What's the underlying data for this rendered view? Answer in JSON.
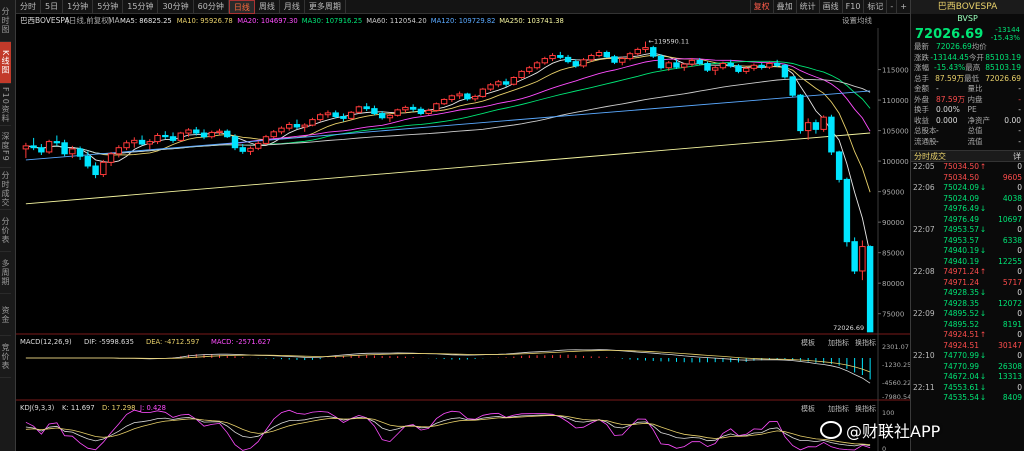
{
  "sidebar": {
    "items": [
      {
        "label": "分时图",
        "active": false
      },
      {
        "label": "K线图",
        "active": true
      },
      {
        "label": "F10资料",
        "active": false
      },
      {
        "label": "深度F9",
        "active": false
      },
      {
        "label": "分时成交",
        "active": false
      },
      {
        "label": "分价表",
        "active": false
      },
      {
        "label": "多周期",
        "active": false
      },
      {
        "label": "资金",
        "active": false
      },
      {
        "label": "竞价表",
        "active": false
      }
    ]
  },
  "toolbar": {
    "periods": [
      "分时",
      "5日",
      "1分钟",
      "5分钟",
      "15分钟",
      "30分钟",
      "60分钟",
      "日线",
      "周线",
      "月线",
      "更多周期"
    ],
    "active_period": "日线",
    "right_items": [
      {
        "label": "复权",
        "color": "red"
      },
      {
        "label": "叠加",
        "color": "normal"
      },
      {
        "label": "统计",
        "color": "normal"
      },
      {
        "label": "画线",
        "color": "normal"
      },
      {
        "label": "F10",
        "color": "normal"
      },
      {
        "label": "标记",
        "color": "normal"
      },
      {
        "label": "-",
        "color": "normal"
      },
      {
        "label": "+",
        "color": "normal"
      }
    ]
  },
  "main_chart": {
    "header": {
      "name": "巴西BOVESPA",
      "mode": "(日线,前复权)",
      "ma_label": "MA",
      "ma_values": [
        {
          "text": "MA5: 86825.25",
          "color": "#e8e8e8"
        },
        {
          "text": "MA10: 95926.78",
          "color": "#e8d06a"
        },
        {
          "text": "MA20: 104697.30",
          "color": "#ff4dff"
        },
        {
          "text": "MA30: 107916.25",
          "color": "#00e676"
        },
        {
          "text": "MA60: 112054.20",
          "color": "#cccccc"
        },
        {
          "text": "MA120: 109729.82",
          "color": "#5aa9ff"
        },
        {
          "text": "MA250: 103741.38",
          "color": "#f5f5a0"
        }
      ],
      "settings": "设置均线"
    },
    "y_ticks": [
      "115000",
      "110000",
      "105000",
      "100000",
      "95000",
      "90000",
      "85000",
      "80000",
      "75000"
    ],
    "high_label": "119590.11",
    "last_label": "72026.69"
  },
  "chart_data": {
    "type": "candlestick",
    "ylim": [
      72000,
      120500
    ],
    "candles": [
      [
        102000,
        103000,
        100500,
        102500
      ],
      [
        102500,
        103800,
        101800,
        102200
      ],
      [
        102200,
        102800,
        101000,
        101500
      ],
      [
        101500,
        103500,
        101200,
        103200
      ],
      [
        103200,
        104200,
        102500,
        103000
      ],
      [
        103000,
        103500,
        100800,
        101200
      ],
      [
        101200,
        102500,
        100500,
        102000
      ],
      [
        102000,
        102400,
        100200,
        100800
      ],
      [
        100800,
        101600,
        98800,
        99200
      ],
      [
        99200,
        99800,
        97200,
        97800
      ],
      [
        97800,
        100200,
        97400,
        99800
      ],
      [
        99800,
        101500,
        99200,
        101200
      ],
      [
        101200,
        102600,
        100600,
        102200
      ],
      [
        102200,
        103400,
        101800,
        103000
      ],
      [
        103000,
        103900,
        102200,
        103400
      ],
      [
        103400,
        104200,
        102600,
        102800
      ],
      [
        102800,
        103600,
        101900,
        103200
      ],
      [
        103200,
        104600,
        102800,
        104200
      ],
      [
        104200,
        104900,
        103600,
        104000
      ],
      [
        104000,
        104700,
        103000,
        103400
      ],
      [
        103400,
        104800,
        103200,
        104600
      ],
      [
        104600,
        105400,
        104000,
        105100
      ],
      [
        105100,
        105600,
        104200,
        104600
      ],
      [
        104600,
        105200,
        103600,
        104000
      ],
      [
        104000,
        105000,
        103700,
        104700
      ],
      [
        104700,
        105300,
        104300,
        104900
      ],
      [
        104900,
        105200,
        103800,
        104000
      ],
      [
        104000,
        104400,
        101800,
        102200
      ],
      [
        102200,
        102800,
        101200,
        101600
      ],
      [
        101600,
        102400,
        101000,
        102100
      ],
      [
        102100,
        103300,
        101800,
        102900
      ],
      [
        102900,
        104300,
        102600,
        104000
      ],
      [
        104000,
        105100,
        103700,
        104800
      ],
      [
        104800,
        105700,
        104400,
        105400
      ],
      [
        105400,
        106400,
        105000,
        106000
      ],
      [
        106000,
        106800,
        105200,
        105600
      ],
      [
        105600,
        106200,
        104800,
        105900
      ],
      [
        105900,
        107100,
        105700,
        106800
      ],
      [
        106800,
        107900,
        106500,
        107600
      ],
      [
        107600,
        108300,
        107100,
        107900
      ],
      [
        107900,
        108300,
        107000,
        107300
      ],
      [
        107300,
        107800,
        106500,
        107000
      ],
      [
        107000,
        108200,
        106800,
        108000
      ],
      [
        108000,
        109100,
        107800,
        108900
      ],
      [
        108900,
        109500,
        108200,
        108600
      ],
      [
        108600,
        109100,
        107500,
        107800
      ],
      [
        107800,
        108200,
        106800,
        107100
      ],
      [
        107100,
        107800,
        106400,
        107500
      ],
      [
        107500,
        108600,
        107300,
        108400
      ],
      [
        108400,
        109100,
        107900,
        108800
      ],
      [
        108800,
        109300,
        108100,
        108500
      ],
      [
        108500,
        108900,
        107500,
        107800
      ],
      [
        107800,
        108600,
        107600,
        108300
      ],
      [
        108300,
        109600,
        108100,
        109400
      ],
      [
        109400,
        110300,
        109200,
        110100
      ],
      [
        110100,
        110900,
        109700,
        110700
      ],
      [
        110700,
        111400,
        110200,
        111000
      ],
      [
        111000,
        111200,
        109900,
        110200
      ],
      [
        110200,
        110900,
        109800,
        110600
      ],
      [
        110600,
        112000,
        110400,
        111800
      ],
      [
        111800,
        112800,
        111500,
        112500
      ],
      [
        112500,
        113300,
        112100,
        113000
      ],
      [
        113000,
        113500,
        112200,
        112600
      ],
      [
        112600,
        113900,
        112400,
        113700
      ],
      [
        113700,
        114900,
        113500,
        114700
      ],
      [
        114700,
        115600,
        114300,
        115300
      ],
      [
        115300,
        116400,
        115000,
        116100
      ],
      [
        116100,
        117100,
        115800,
        116800
      ],
      [
        116800,
        117700,
        116400,
        117300
      ],
      [
        117300,
        117900,
        116700,
        117000
      ],
      [
        117000,
        117400,
        116000,
        116300
      ],
      [
        116300,
        116700,
        115300,
        115600
      ],
      [
        115600,
        116900,
        115300,
        116600
      ],
      [
        116600,
        117600,
        116300,
        117300
      ],
      [
        117300,
        118200,
        117000,
        117800
      ],
      [
        117800,
        118100,
        116900,
        117100
      ],
      [
        117100,
        117400,
        115900,
        116200
      ],
      [
        116200,
        117100,
        115700,
        116800
      ],
      [
        116800,
        117900,
        116500,
        117600
      ],
      [
        117600,
        118600,
        117300,
        118300
      ],
      [
        118300,
        119590,
        117800,
        118600
      ],
      [
        118600,
        118900,
        116900,
        117200
      ],
      [
        117200,
        117500,
        115000,
        115300
      ],
      [
        115300,
        116400,
        114800,
        116100
      ],
      [
        116100,
        116700,
        115100,
        115400
      ],
      [
        115400,
        116100,
        114800,
        115900
      ],
      [
        115900,
        116900,
        115500,
        116500
      ],
      [
        116500,
        116900,
        115700,
        116000
      ],
      [
        116000,
        116300,
        114600,
        114900
      ],
      [
        114900,
        115600,
        114100,
        115300
      ],
      [
        115300,
        116300,
        115000,
        116000
      ],
      [
        116000,
        116600,
        115300,
        115600
      ],
      [
        115600,
        115900,
        114400,
        114700
      ],
      [
        114700,
        115500,
        114300,
        115200
      ],
      [
        115200,
        116000,
        114800,
        115700
      ],
      [
        115700,
        116100,
        115000,
        115400
      ],
      [
        115400,
        116300,
        115100,
        116000
      ],
      [
        116000,
        116600,
        115400,
        115700
      ],
      [
        115700,
        115900,
        113500,
        113800
      ],
      [
        113800,
        113900,
        110500,
        110800
      ],
      [
        110800,
        111000,
        104500,
        105000
      ],
      [
        105000,
        107000,
        103500,
        106300
      ],
      [
        106300,
        106800,
        104500,
        105200
      ],
      [
        105200,
        107500,
        104800,
        107200
      ],
      [
        107200,
        107600,
        101000,
        101500
      ],
      [
        101500,
        101700,
        96500,
        97000
      ],
      [
        97000,
        97300,
        86000,
        86800
      ],
      [
        86800,
        87500,
        81500,
        82000
      ],
      [
        82000,
        87000,
        80500,
        86000
      ],
      [
        86000,
        86200,
        72000,
        72026
      ]
    ],
    "ma_series": [
      {
        "name": "MA5",
        "color": "#e8e8e8"
      },
      {
        "name": "MA10",
        "color": "#e8d06a"
      },
      {
        "name": "MA20",
        "color": "#ff4dff"
      },
      {
        "name": "MA30",
        "color": "#00e676"
      },
      {
        "name": "MA60",
        "color": "#cccccc"
      },
      {
        "name": "MA120",
        "color": "#5aa9ff",
        "values": [
          100200,
          111500
        ]
      },
      {
        "name": "MA250",
        "color": "#f5f5a0",
        "values": [
          93000,
          104600
        ]
      }
    ],
    "macd": {
      "header": "MACD(12,26,9)",
      "dif": "DIF: -5998.635",
      "dea": "DEA: -4712.597",
      "macd": "MACD: -2571.627",
      "y_ticks": [
        "2301.07",
        "-1230.25",
        "-4560.22",
        "-7980.54"
      ],
      "buttons": [
        "模板",
        "加指标",
        "换指标"
      ]
    },
    "kdj": {
      "header": "KDJ(9,3,3)",
      "k": "K: 11.697",
      "d": "D: 17.298",
      "j": "J: 0.428",
      "y_ticks": [
        "100",
        "50",
        "0"
      ],
      "buttons": [
        "模板",
        "加指标",
        "换指标"
      ]
    }
  },
  "quote_panel": {
    "name": "巴西BOVESPA",
    "code": "BVSP",
    "price": "72026.69",
    "change": "-13144",
    "change_pct": "-15.43%",
    "rows": [
      {
        "l": "最新",
        "v": "72026.69",
        "l2": "均价",
        "v2": "",
        "c": "green"
      },
      {
        "l": "涨跌",
        "v": "-13144.45",
        "l2": "今开",
        "v2": "85103.19",
        "c": "green"
      },
      {
        "l": "涨幅",
        "v": "-15.43%",
        "l2": "最高",
        "v2": "85103.19",
        "c": "green"
      },
      {
        "l": "总手",
        "v": "87.59万",
        "l2": "最低",
        "v2": "72026.69",
        "c": "yellow"
      },
      {
        "l": "金额",
        "v": "-",
        "l2": "量比",
        "v2": "-",
        "c": "white"
      },
      {
        "l": "外盘",
        "v": "87.59万",
        "l2": "内盘",
        "v2": "-",
        "c": "red"
      },
      {
        "l": "换手",
        "v": "0.00%",
        "l2": "PE",
        "v2": "-",
        "c": "white"
      },
      {
        "l": "收益",
        "v": "0.000",
        "l2": "净资产",
        "v2": "0.00",
        "c": "white"
      },
      {
        "l": "总股本",
        "v": "-",
        "l2": "总值",
        "v2": "-",
        "c": "white"
      },
      {
        "l": "流通股",
        "v": "-",
        "l2": "流值",
        "v2": "-",
        "c": "white"
      }
    ],
    "ticks_title": "分时成交",
    "ticks_more": "详",
    "ticks": [
      {
        "t": "22:05",
        "p": "75034.50",
        "a": "↑",
        "v": "0",
        "c": "red"
      },
      {
        "t": "",
        "p": "75034.50",
        "a": "",
        "v": "9605",
        "c": "red"
      },
      {
        "t": "22:06",
        "p": "75024.09",
        "a": "↓",
        "v": "0",
        "c": "green"
      },
      {
        "t": "",
        "p": "75024.09",
        "a": "",
        "v": "4038",
        "c": "green"
      },
      {
        "t": "",
        "p": "74976.49",
        "a": "↓",
        "v": "0",
        "c": "green"
      },
      {
        "t": "",
        "p": "74976.49",
        "a": "",
        "v": "10697",
        "c": "green"
      },
      {
        "t": "22:07",
        "p": "74953.57",
        "a": "↓",
        "v": "0",
        "c": "green"
      },
      {
        "t": "",
        "p": "74953.57",
        "a": "",
        "v": "6338",
        "c": "green"
      },
      {
        "t": "",
        "p": "74940.19",
        "a": "↓",
        "v": "0",
        "c": "green"
      },
      {
        "t": "",
        "p": "74940.19",
        "a": "",
        "v": "12255",
        "c": "green"
      },
      {
        "t": "22:08",
        "p": "74971.24",
        "a": "↑",
        "v": "0",
        "c": "red"
      },
      {
        "t": "",
        "p": "74971.24",
        "a": "",
        "v": "5717",
        "c": "red"
      },
      {
        "t": "",
        "p": "74928.35",
        "a": "↓",
        "v": "0",
        "c": "green"
      },
      {
        "t": "",
        "p": "74928.35",
        "a": "",
        "v": "12072",
        "c": "green"
      },
      {
        "t": "22:09",
        "p": "74895.52",
        "a": "↓",
        "v": "0",
        "c": "green"
      },
      {
        "t": "",
        "p": "74895.52",
        "a": "",
        "v": "8191",
        "c": "green"
      },
      {
        "t": "",
        "p": "74924.51",
        "a": "↑",
        "v": "0",
        "c": "red"
      },
      {
        "t": "",
        "p": "74924.51",
        "a": "",
        "v": "30147",
        "c": "red"
      },
      {
        "t": "22:10",
        "p": "74770.99",
        "a": "↓",
        "v": "0",
        "c": "green"
      },
      {
        "t": "",
        "p": "74770.99",
        "a": "",
        "v": "26308",
        "c": "green"
      },
      {
        "t": "",
        "p": "74672.04",
        "a": "↓",
        "v": "13313",
        "c": "green"
      },
      {
        "t": "22:11",
        "p": "74553.61",
        "a": "↓",
        "v": "0",
        "c": "green"
      },
      {
        "t": "",
        "p": "74535.54",
        "a": "↓",
        "v": "8409",
        "c": "green"
      }
    ]
  },
  "watermark": {
    "text": "@财联社APP"
  }
}
